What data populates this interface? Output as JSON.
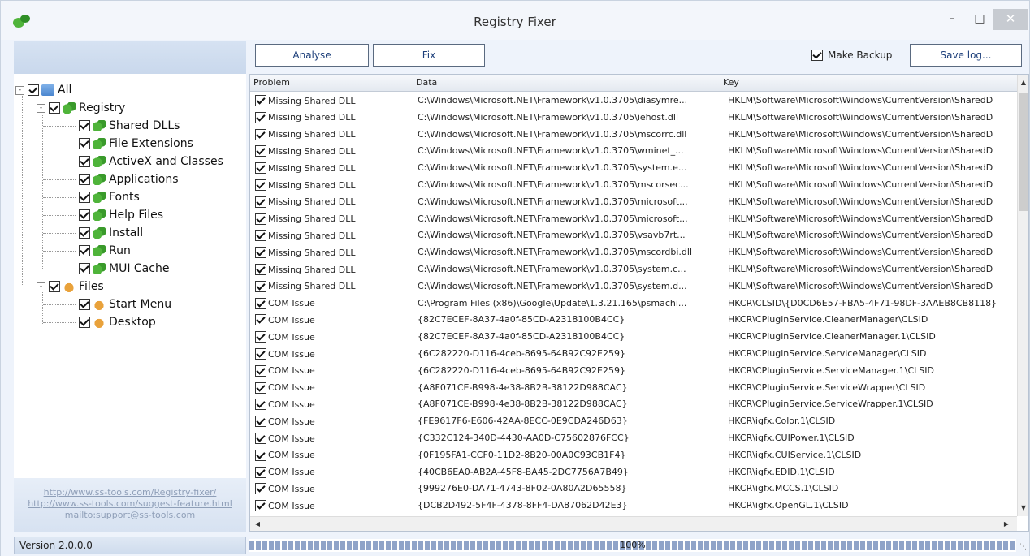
{
  "window": {
    "title": "Registry Fixer",
    "minimize": "–",
    "maximize": "□",
    "close": "✕"
  },
  "toolbar": {
    "analyse_label": "Analyse",
    "fix_label": "Fix",
    "make_backup_label": "Make Backup",
    "make_backup_checked": true,
    "save_log_label": "Save log..."
  },
  "tree": [
    {
      "label": "All",
      "icon": "all-icon",
      "checked": true
    },
    {
      "label": "Registry",
      "icon": "registry-icon",
      "checked": true
    },
    {
      "label": "Shared DLLs",
      "icon": "registry-icon",
      "checked": true
    },
    {
      "label": "File Extensions",
      "icon": "registry-icon",
      "checked": true
    },
    {
      "label": "ActiveX and Classes",
      "icon": "registry-icon",
      "checked": true
    },
    {
      "label": "Applications",
      "icon": "registry-icon",
      "checked": true
    },
    {
      "label": "Fonts",
      "icon": "registry-icon",
      "checked": true
    },
    {
      "label": "Help Files",
      "icon": "registry-icon",
      "checked": true
    },
    {
      "label": "Install",
      "icon": "registry-icon",
      "checked": true
    },
    {
      "label": "Run",
      "icon": "registry-icon",
      "checked": true
    },
    {
      "label": "MUI Cache",
      "icon": "registry-icon",
      "checked": true
    },
    {
      "label": "Files",
      "icon": "files-icon",
      "checked": true
    },
    {
      "label": "Start Menu",
      "icon": "files-icon",
      "checked": true
    },
    {
      "label": "Desktop",
      "icon": "files-icon",
      "checked": true
    }
  ],
  "links": [
    "http://www.ss-tools.com/Registry-fixer/",
    "http://www.ss-tools.com/suggest-feature.html",
    "mailto:support@ss-tools.com"
  ],
  "grid": {
    "columns": {
      "problem": "Problem",
      "data": "Data",
      "key": "Key"
    },
    "rows": [
      {
        "problem": "Missing Shared DLL",
        "data": "C:\\Windows\\Microsoft.NET\\Framework\\v1.0.3705\\diasymre...",
        "key": "HKLM\\Software\\Microsoft\\Windows\\CurrentVersion\\SharedD"
      },
      {
        "problem": "Missing Shared DLL",
        "data": "C:\\Windows\\Microsoft.NET\\Framework\\v1.0.3705\\iehost.dll",
        "key": "HKLM\\Software\\Microsoft\\Windows\\CurrentVersion\\SharedD"
      },
      {
        "problem": "Missing Shared DLL",
        "data": "C:\\Windows\\Microsoft.NET\\Framework\\v1.0.3705\\mscorrc.dll",
        "key": "HKLM\\Software\\Microsoft\\Windows\\CurrentVersion\\SharedD"
      },
      {
        "problem": "Missing Shared DLL",
        "data": "C:\\Windows\\Microsoft.NET\\Framework\\v1.0.3705\\wminet_...",
        "key": "HKLM\\Software\\Microsoft\\Windows\\CurrentVersion\\SharedD"
      },
      {
        "problem": "Missing Shared DLL",
        "data": "C:\\Windows\\Microsoft.NET\\Framework\\v1.0.3705\\system.e...",
        "key": "HKLM\\Software\\Microsoft\\Windows\\CurrentVersion\\SharedD"
      },
      {
        "problem": "Missing Shared DLL",
        "data": "C:\\Windows\\Microsoft.NET\\Framework\\v1.0.3705\\mscorsec...",
        "key": "HKLM\\Software\\Microsoft\\Windows\\CurrentVersion\\SharedD"
      },
      {
        "problem": "Missing Shared DLL",
        "data": "C:\\Windows\\Microsoft.NET\\Framework\\v1.0.3705\\microsoft...",
        "key": "HKLM\\Software\\Microsoft\\Windows\\CurrentVersion\\SharedD"
      },
      {
        "problem": "Missing Shared DLL",
        "data": "C:\\Windows\\Microsoft.NET\\Framework\\v1.0.3705\\microsoft...",
        "key": "HKLM\\Software\\Microsoft\\Windows\\CurrentVersion\\SharedD"
      },
      {
        "problem": "Missing Shared DLL",
        "data": "C:\\Windows\\Microsoft.NET\\Framework\\v1.0.3705\\vsavb7rt...",
        "key": "HKLM\\Software\\Microsoft\\Windows\\CurrentVersion\\SharedD"
      },
      {
        "problem": "Missing Shared DLL",
        "data": "C:\\Windows\\Microsoft.NET\\Framework\\v1.0.3705\\mscordbi.dll",
        "key": "HKLM\\Software\\Microsoft\\Windows\\CurrentVersion\\SharedD"
      },
      {
        "problem": "Missing Shared DLL",
        "data": "C:\\Windows\\Microsoft.NET\\Framework\\v1.0.3705\\system.c...",
        "key": "HKLM\\Software\\Microsoft\\Windows\\CurrentVersion\\SharedD"
      },
      {
        "problem": "Missing Shared DLL",
        "data": "C:\\Windows\\Microsoft.NET\\Framework\\v1.0.3705\\system.d...",
        "key": "HKLM\\Software\\Microsoft\\Windows\\CurrentVersion\\SharedD"
      },
      {
        "problem": "COM Issue",
        "data": "C:\\Program Files (x86)\\Google\\Update\\1.3.21.165\\psmachi...",
        "key": "HKCR\\CLSID\\{D0CD6E57-FBA5-4F71-98DF-3AAEB8CB8118}"
      },
      {
        "problem": "COM Issue",
        "data": "{82C7ECEF-8A37-4a0f-85CD-A2318100B4CC}",
        "key": "HKCR\\CPluginService.CleanerManager\\CLSID"
      },
      {
        "problem": "COM Issue",
        "data": "{82C7ECEF-8A37-4a0f-85CD-A2318100B4CC}",
        "key": "HKCR\\CPluginService.CleanerManager.1\\CLSID"
      },
      {
        "problem": "COM Issue",
        "data": "{6C282220-D116-4ceb-8695-64B92C92E259}",
        "key": "HKCR\\CPluginService.ServiceManager\\CLSID"
      },
      {
        "problem": "COM Issue",
        "data": "{6C282220-D116-4ceb-8695-64B92C92E259}",
        "key": "HKCR\\CPluginService.ServiceManager.1\\CLSID"
      },
      {
        "problem": "COM Issue",
        "data": "{A8F071CE-B998-4e38-8B2B-38122D988CAC}",
        "key": "HKCR\\CPluginService.ServiceWrapper\\CLSID"
      },
      {
        "problem": "COM Issue",
        "data": "{A8F071CE-B998-4e38-8B2B-38122D988CAC}",
        "key": "HKCR\\CPluginService.ServiceWrapper.1\\CLSID"
      },
      {
        "problem": "COM Issue",
        "data": "{FE9617F6-E606-42AA-8ECC-0E9CDA246D63}",
        "key": "HKCR\\igfx.Color.1\\CLSID"
      },
      {
        "problem": "COM Issue",
        "data": "{C332C124-340D-4430-AA0D-C75602876FCC}",
        "key": "HKCR\\igfx.CUIPower.1\\CLSID"
      },
      {
        "problem": "COM Issue",
        "data": "{0F195FA1-CCF0-11D2-8B20-00A0C93CB1F4}",
        "key": "HKCR\\igfx.CUIService.1\\CLSID"
      },
      {
        "problem": "COM Issue",
        "data": "{40CB6EA0-AB2A-45F8-BA45-2DC7756A7B49}",
        "key": "HKCR\\igfx.EDID.1\\CLSID"
      },
      {
        "problem": "COM Issue",
        "data": "{999276E0-DA71-4743-8F02-0A80A2D65558}",
        "key": "HKCR\\igfx.MCCS.1\\CLSID"
      },
      {
        "problem": "COM Issue",
        "data": "{DCB2D492-5F4F-4378-8FF4-DA87062D42E3}",
        "key": "HKCR\\igfx.OpenGL.1\\CLSID"
      }
    ]
  },
  "status": {
    "version": "Version 2.0.0.0",
    "progress_text": "100%",
    "progress_fraction": 1.0
  },
  "colors": {
    "accent": "#1d3f7a",
    "selection_bg": "#d6e2f2",
    "progress": "#8fa3c8"
  }
}
